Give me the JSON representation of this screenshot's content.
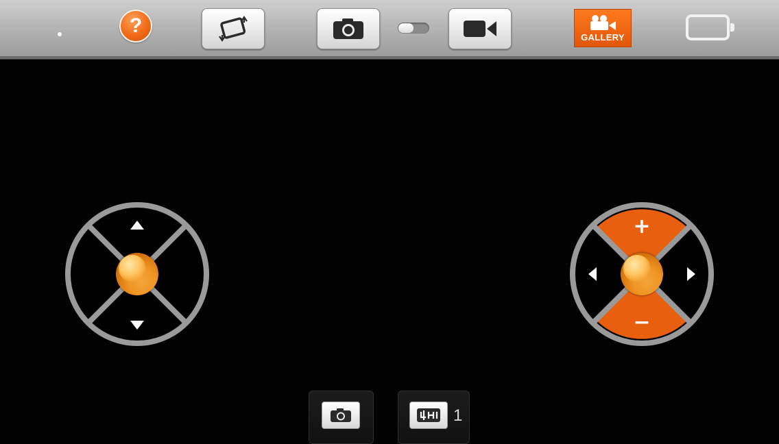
{
  "toolbar": {
    "help_label": "?",
    "rotate_icon": "rotate-screen-icon",
    "photo_icon": "camera-icon",
    "video_icon": "video-camera-icon",
    "mode_toggle": "photo-video-switch",
    "gallery_label": "GALLERY",
    "gallery_icon": "film-camera-icon",
    "battery_icon": "battery-empty-icon"
  },
  "left_stick": {
    "up_icon": "arrow-up-icon",
    "down_icon": "arrow-down-icon"
  },
  "right_stick": {
    "plus_label": "+",
    "minus_label": "−",
    "left_icon": "arrow-left-icon",
    "right_icon": "arrow-right-icon"
  },
  "bottom": {
    "photo_icon": "camera-icon",
    "burst_icon": "burst-icon",
    "burst_count": "1"
  },
  "colors": {
    "accent_orange": "#e8600f",
    "ring_gray": "#9a9a9a",
    "background": "#020203"
  }
}
